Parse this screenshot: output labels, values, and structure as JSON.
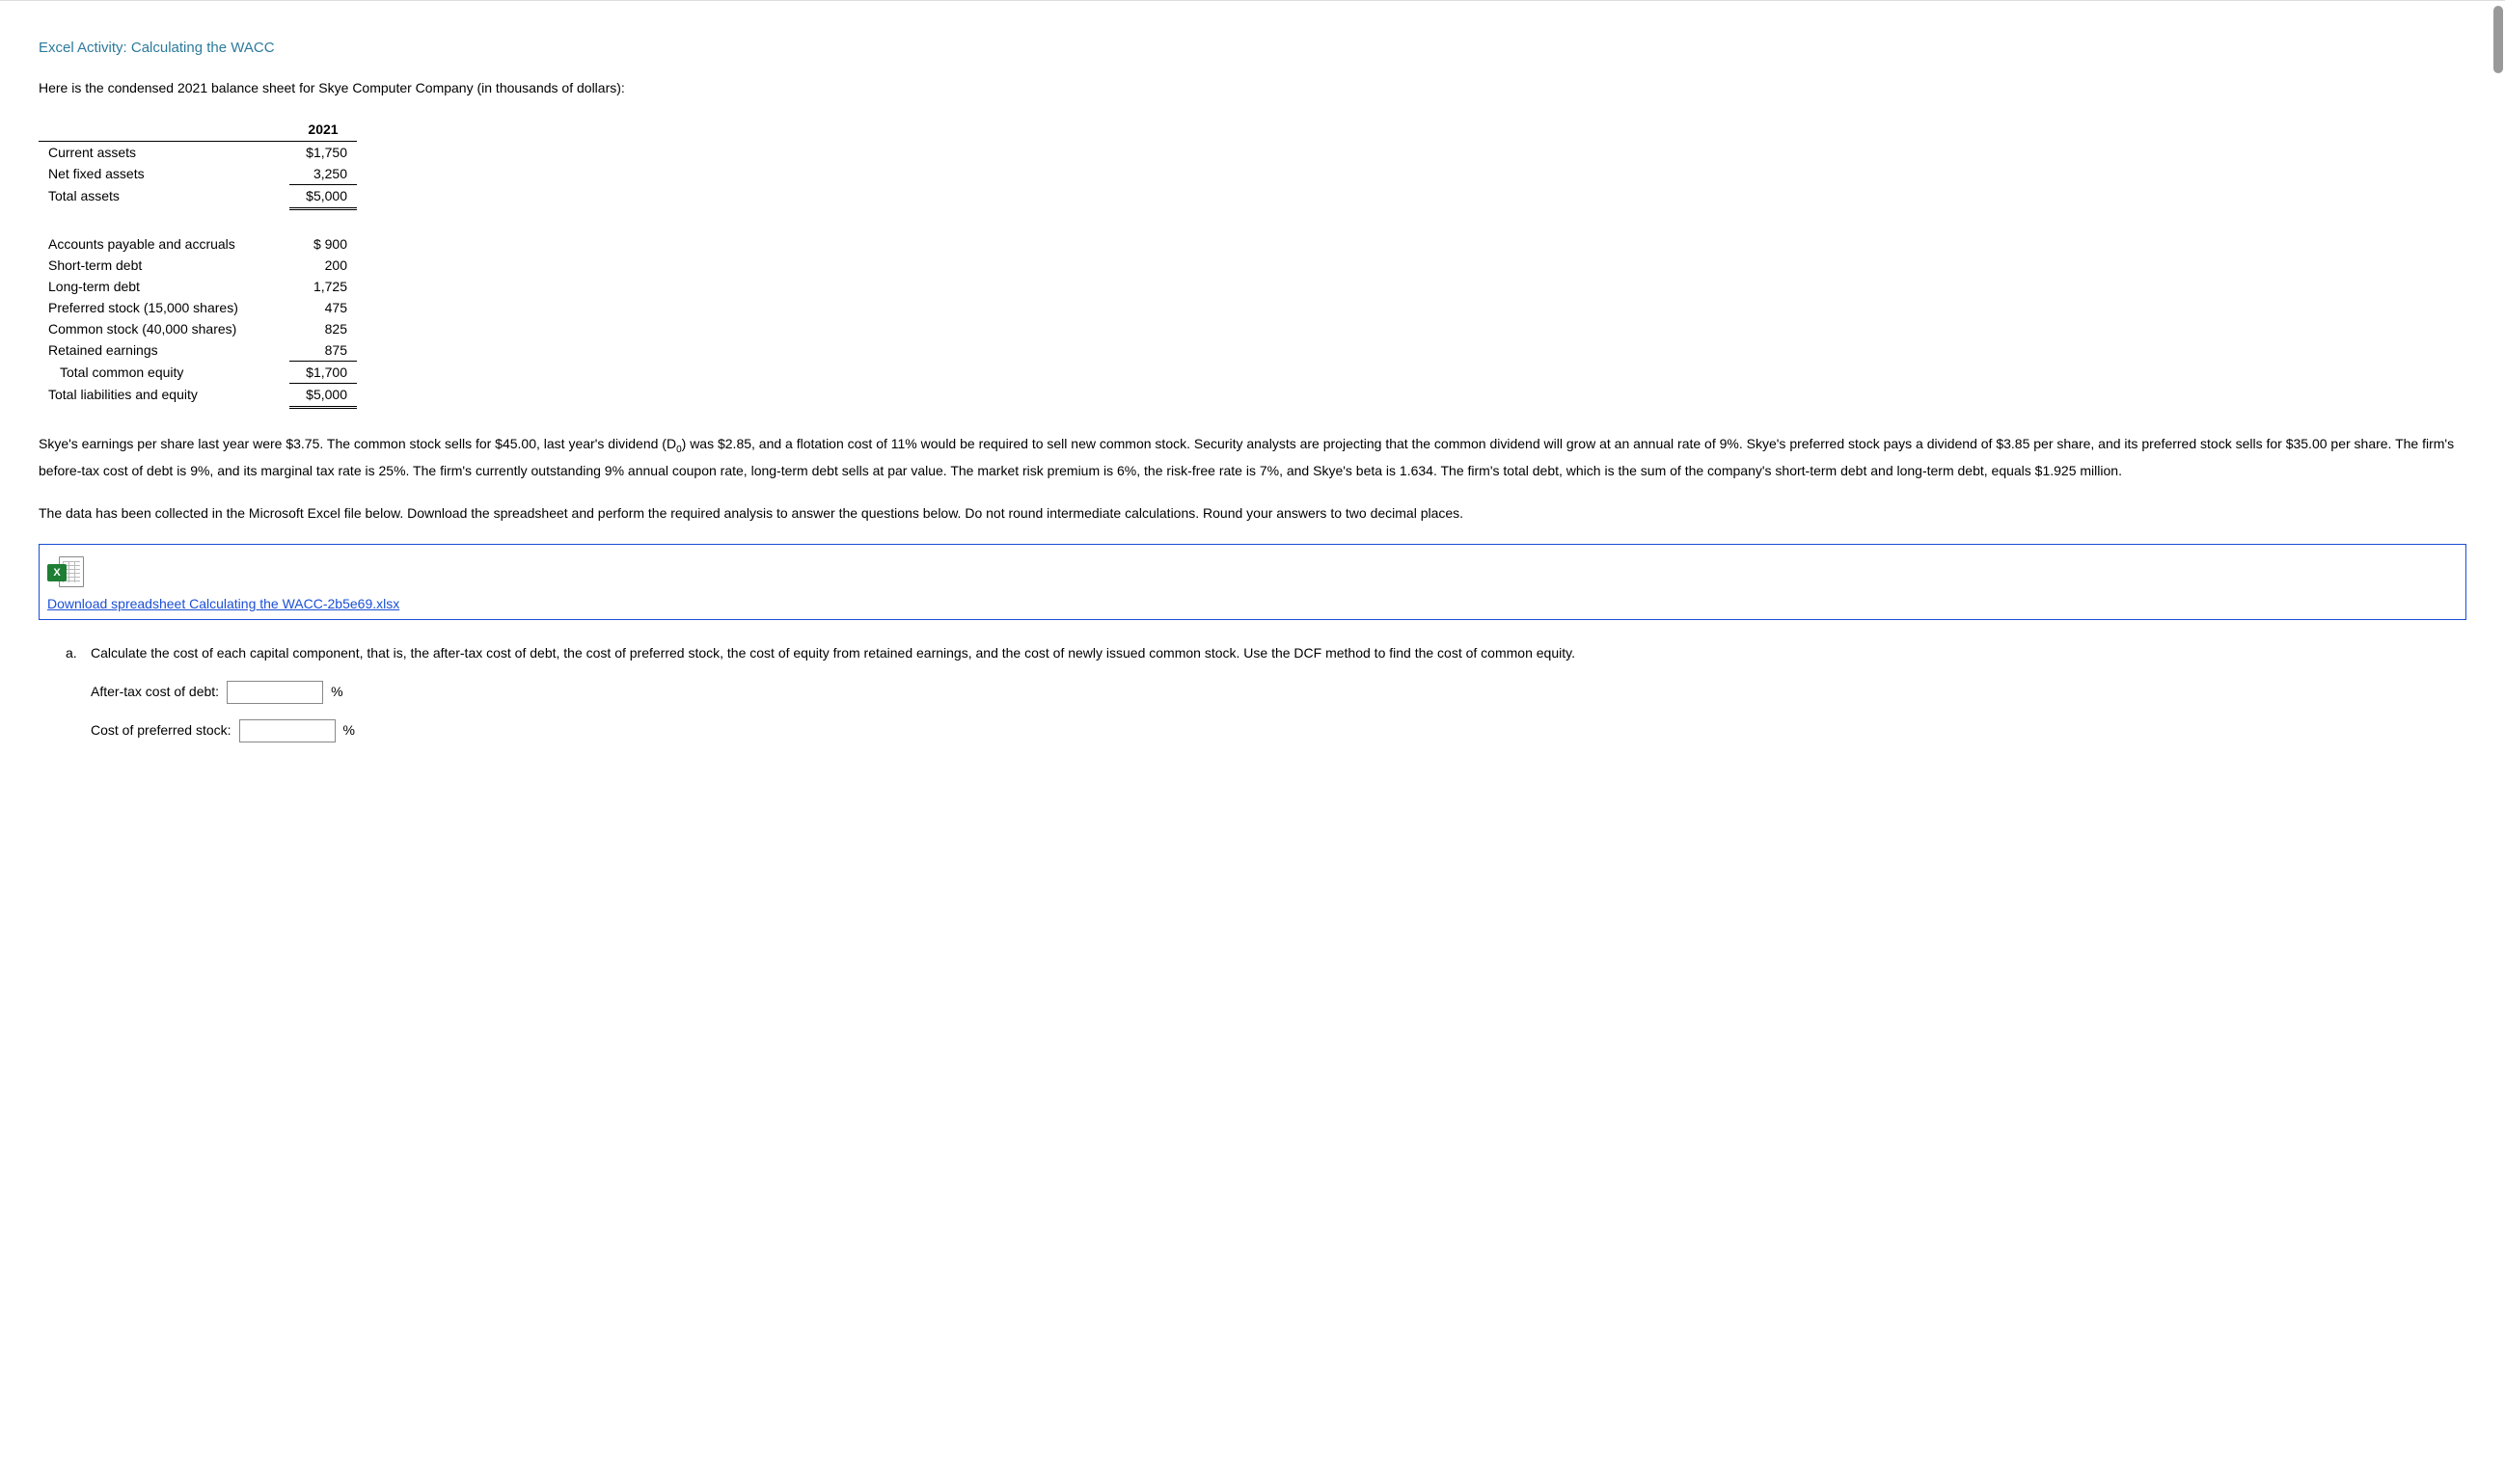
{
  "title": "Excel Activity: Calculating the WACC",
  "intro": "Here is the condensed 2021 balance sheet for Skye Computer Company (in thousands of dollars):",
  "balance_sheet": {
    "year_header": "2021",
    "assets": {
      "rows": [
        {
          "label": "Current assets",
          "value": "$1,750"
        },
        {
          "label": "Net fixed assets",
          "value": "3,250"
        }
      ],
      "total": {
        "label": "Total assets",
        "value": "$5,000"
      }
    },
    "liab_equity": {
      "rows": [
        {
          "label": "Accounts payable and accruals",
          "value": "$   900"
        },
        {
          "label": "Short-term debt",
          "value": "200"
        },
        {
          "label": "Long-term debt",
          "value": "1,725"
        },
        {
          "label": "Preferred stock (15,000 shares)",
          "value": "475"
        },
        {
          "label": "Common stock (40,000 shares)",
          "value": "825"
        },
        {
          "label": "Retained earnings",
          "value": "875"
        }
      ],
      "subtotal": {
        "label": "Total common equity",
        "value": "$1,700"
      },
      "total": {
        "label": "Total liabilities and equity",
        "value": "$5,000"
      }
    }
  },
  "para1_pre": "Skye's earnings per share last year were $3.75. The common stock sells for $45.00, last year's dividend (D",
  "para1_sub": "0",
  "para1_post": ") was $2.85, and a flotation cost of 11% would be required to sell new common stock. Security analysts are projecting that the common dividend will grow at an annual rate of 9%. Skye's preferred stock pays a dividend of $3.85 per share, and its preferred stock sells for $35.00 per share. The firm's before-tax cost of debt is 9%, and its marginal tax rate is 25%. The firm's currently outstanding 9% annual coupon rate, long-term debt sells at par value. The market risk premium is 6%, the risk-free rate is 7%, and Skye's beta is 1.634. The firm's total debt, which is the sum of the company's short-term debt and long-term debt, equals $1.925 million.",
  "para2": "The data has been collected in the Microsoft Excel file below. Download the spreadsheet and perform the required analysis to answer the questions below. Do not round intermediate calculations. Round your answers to two decimal places.",
  "download": {
    "icon_letter": "X",
    "link_text": "Download spreadsheet Calculating the WACC-2b5e69.xlsx"
  },
  "question_a": {
    "marker": "a.",
    "text": "Calculate the cost of each capital component, that is, the after-tax cost of debt, the cost of preferred stock, the cost of equity from retained earnings, and the cost of newly issued common stock. Use the DCF method to find the cost of common equity.",
    "inputs": [
      {
        "label": "After-tax cost of debt:",
        "unit": "%"
      },
      {
        "label": "Cost of preferred stock:",
        "unit": "%"
      }
    ]
  }
}
